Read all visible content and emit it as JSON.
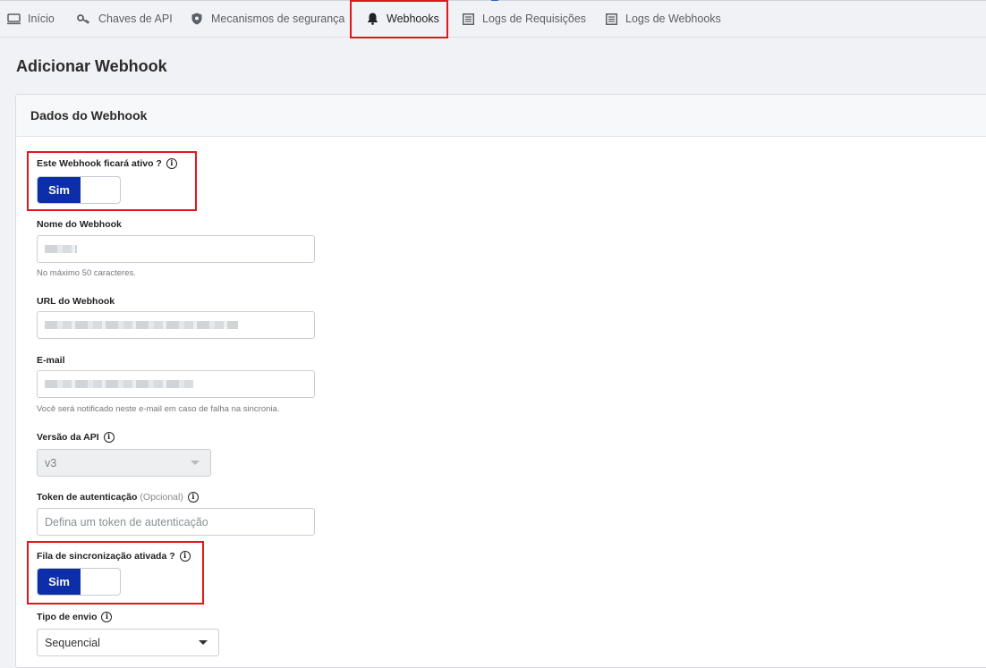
{
  "tabs": [
    {
      "label": "Início",
      "icon": "monitor-icon"
    },
    {
      "label": "Chaves de API",
      "icon": "key-icon"
    },
    {
      "label": "Mecanismos de segurança",
      "icon": "shield-icon"
    },
    {
      "label": "Webhooks",
      "icon": "bell-icon"
    },
    {
      "label": "Logs de Requisições",
      "icon": "list-icon"
    },
    {
      "label": "Logs de Webhooks",
      "icon": "list-icon"
    }
  ],
  "page_title": "Adicionar Webhook",
  "card_title": "Dados do Webhook",
  "form": {
    "active": {
      "label": "Este Webhook ficará ativo ?",
      "value": "Sim"
    },
    "name": {
      "label": "Nome do Webhook",
      "help": "No máximo 50 caracteres."
    },
    "url": {
      "label": "URL do Webhook"
    },
    "email": {
      "label": "E-mail",
      "help": "Você será notificado neste e-mail em caso de falha na sincronia."
    },
    "api_version": {
      "label": "Versão da API",
      "value": "v3"
    },
    "token": {
      "label": "Token de autenticação",
      "optional": "(Opcional)",
      "placeholder": "Defina um token de autenticação"
    },
    "queue": {
      "label": "Fila de sincronização ativada ?",
      "value": "Sim"
    },
    "send_type": {
      "label": "Tipo de envio",
      "value": "Sequencial"
    }
  },
  "colors": {
    "accent": "#0c2ea8",
    "highlight": "#e3161c"
  }
}
